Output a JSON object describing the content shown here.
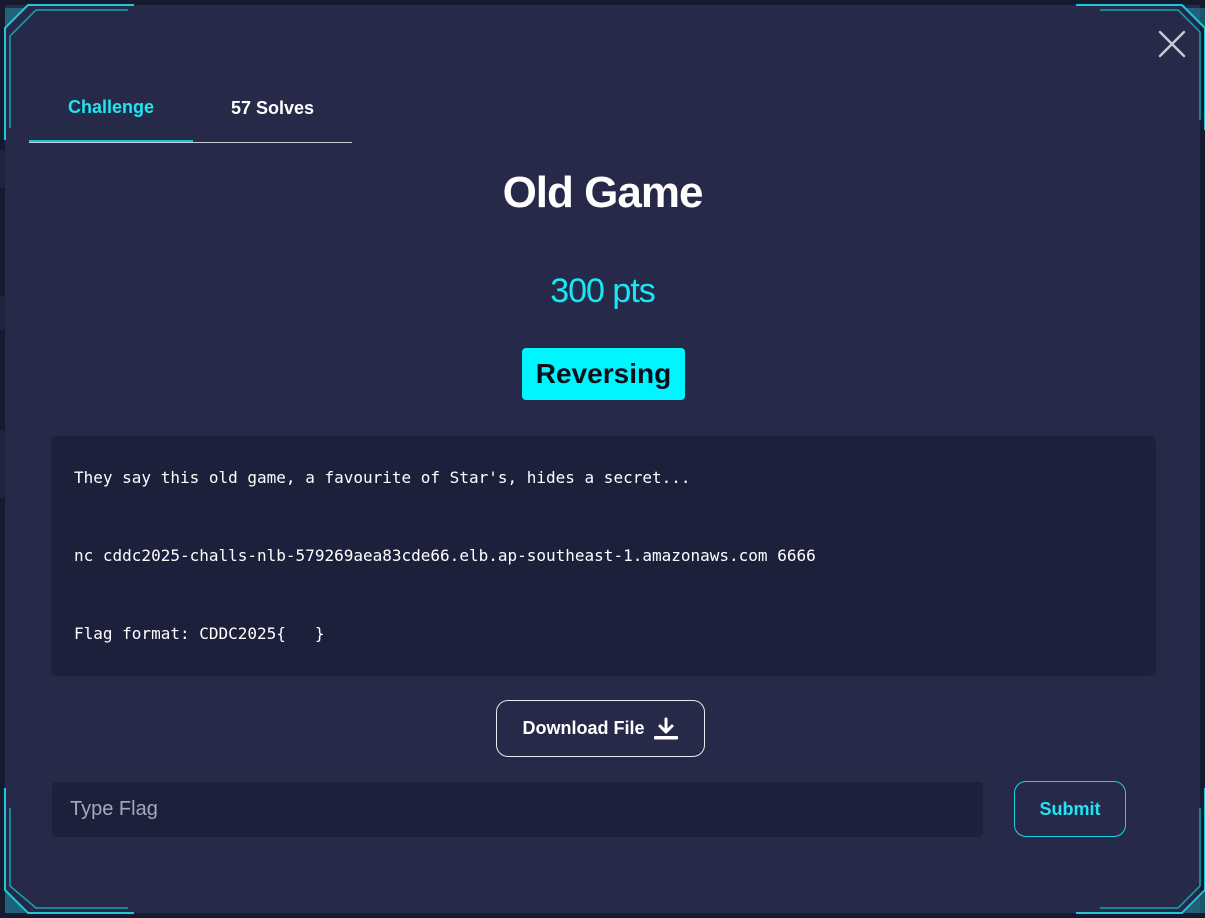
{
  "tabs": [
    {
      "label": "Challenge",
      "active": true
    },
    {
      "label": "57 Solves",
      "active": false
    }
  ],
  "challenge": {
    "title": "Old Game",
    "points": "300 pts",
    "category": "Reversing",
    "description": [
      "They say this old game, a favourite of Star's, hides a secret...",
      "nc cddc2025-challs-nlb-579269aea83cde66.elb.ap-southeast-1.amazonaws.com 6666",
      "Flag format: CDDC2025{   }"
    ]
  },
  "download": {
    "label": "Download File",
    "icon": "download-icon"
  },
  "flag_input": {
    "placeholder": "Type Flag",
    "value": ""
  },
  "submit": {
    "label": "Submit"
  },
  "icons": {
    "close": "close-icon"
  },
  "colors": {
    "accent": "#00f6ff",
    "modal_bg": "#262a48",
    "panel_bg": "#1c203a",
    "frame": "#1ec8d8"
  }
}
